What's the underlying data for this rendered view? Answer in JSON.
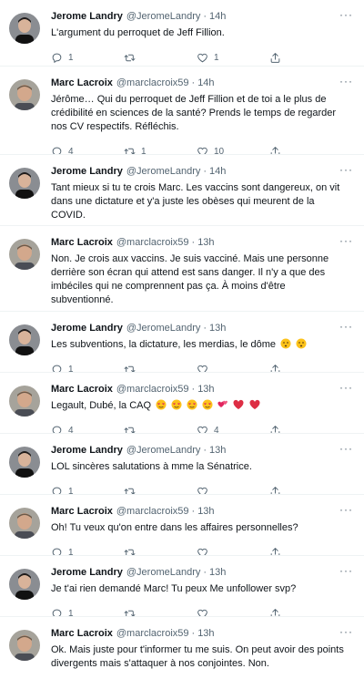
{
  "more_glyph": "···",
  "dot": "·",
  "icons": {
    "reply": "reply-icon",
    "retweet": "retweet-icon",
    "like": "heart-icon",
    "share": "share-icon",
    "more": "more-icon"
  },
  "colors": {
    "text": "#0f1419",
    "secondary": "#536471",
    "divider": "#eff3f4",
    "heart": "#e0245e"
  },
  "tweets": [
    {
      "name": "Jerome Landry",
      "handle": "@JeromeLandry",
      "time": "14h",
      "text": "L'argument du perroquet de Jeff Fillion.",
      "replies": "1",
      "retweets": "",
      "likes": "1"
    },
    {
      "name": "Marc Lacroix",
      "handle": "@marclacroix59",
      "time": "14h",
      "text": "Jérôme… Qui du perroquet de Jeff Fillion et de toi a le plus de crédibilité en sciences de la santé? Prends le temps de regarder nos CV respectifs. Réfléchis.",
      "replies": "4",
      "retweets": "1",
      "likes": "10"
    },
    {
      "name": "Jerome Landry",
      "handle": "@JeromeLandry",
      "time": "14h",
      "text": "Tant mieux si tu te crois Marc. Les vaccins sont dangereux, on vit dans une dictature et y'a juste les obèses qui meurent de la COVID.",
      "replies": "1",
      "retweets": "1",
      "likes": "1"
    },
    {
      "name": "Marc Lacroix",
      "handle": "@marclacroix59",
      "time": "13h",
      "text": "Non. Je crois aux vaccins. Je suis vacciné. Mais une personne derrière son écran qui attend est sans danger. Il n'y a que des imbéciles qui ne comprennent pas ça. À moins d'être subventionné.",
      "replies": "1",
      "retweets": "",
      "likes": "7"
    },
    {
      "name": "Jerome Landry",
      "handle": "@JeromeLandry",
      "time": "13h",
      "text": "Les subventions, la dictature, les merdias, le dôme",
      "replies": "1",
      "retweets": "",
      "likes": ""
    },
    {
      "name": "Marc Lacroix",
      "handle": "@marclacroix59",
      "time": "13h",
      "text": "Legault, Dubé, la CAQ",
      "replies": "4",
      "retweets": "",
      "likes": "4"
    },
    {
      "name": "Jerome Landry",
      "handle": "@JeromeLandry",
      "time": "13h",
      "text": "LOL sincères salutations à mme la Sénatrice.",
      "replies": "1",
      "retweets": "",
      "likes": ""
    },
    {
      "name": "Marc Lacroix",
      "handle": "@marclacroix59",
      "time": "13h",
      "text": "Oh! Tu veux qu'on entre dans les affaires personnelles?",
      "replies": "1",
      "retweets": "",
      "likes": ""
    },
    {
      "name": "Jerome Landry",
      "handle": "@JeromeLandry",
      "time": "13h",
      "text": "Je t'ai rien demandé Marc! Tu peux Me unfollower svp?",
      "replies": "1",
      "retweets": "",
      "likes": ""
    },
    {
      "name": "Marc Lacroix",
      "handle": "@marclacroix59",
      "time": "13h",
      "text": "Ok. Mais juste pour t'informer tu me suis. On peut avoir des points divergents mais s'attaquer à nos conjointes. Non.",
      "replies": "",
      "retweets": "",
      "likes": ""
    }
  ]
}
